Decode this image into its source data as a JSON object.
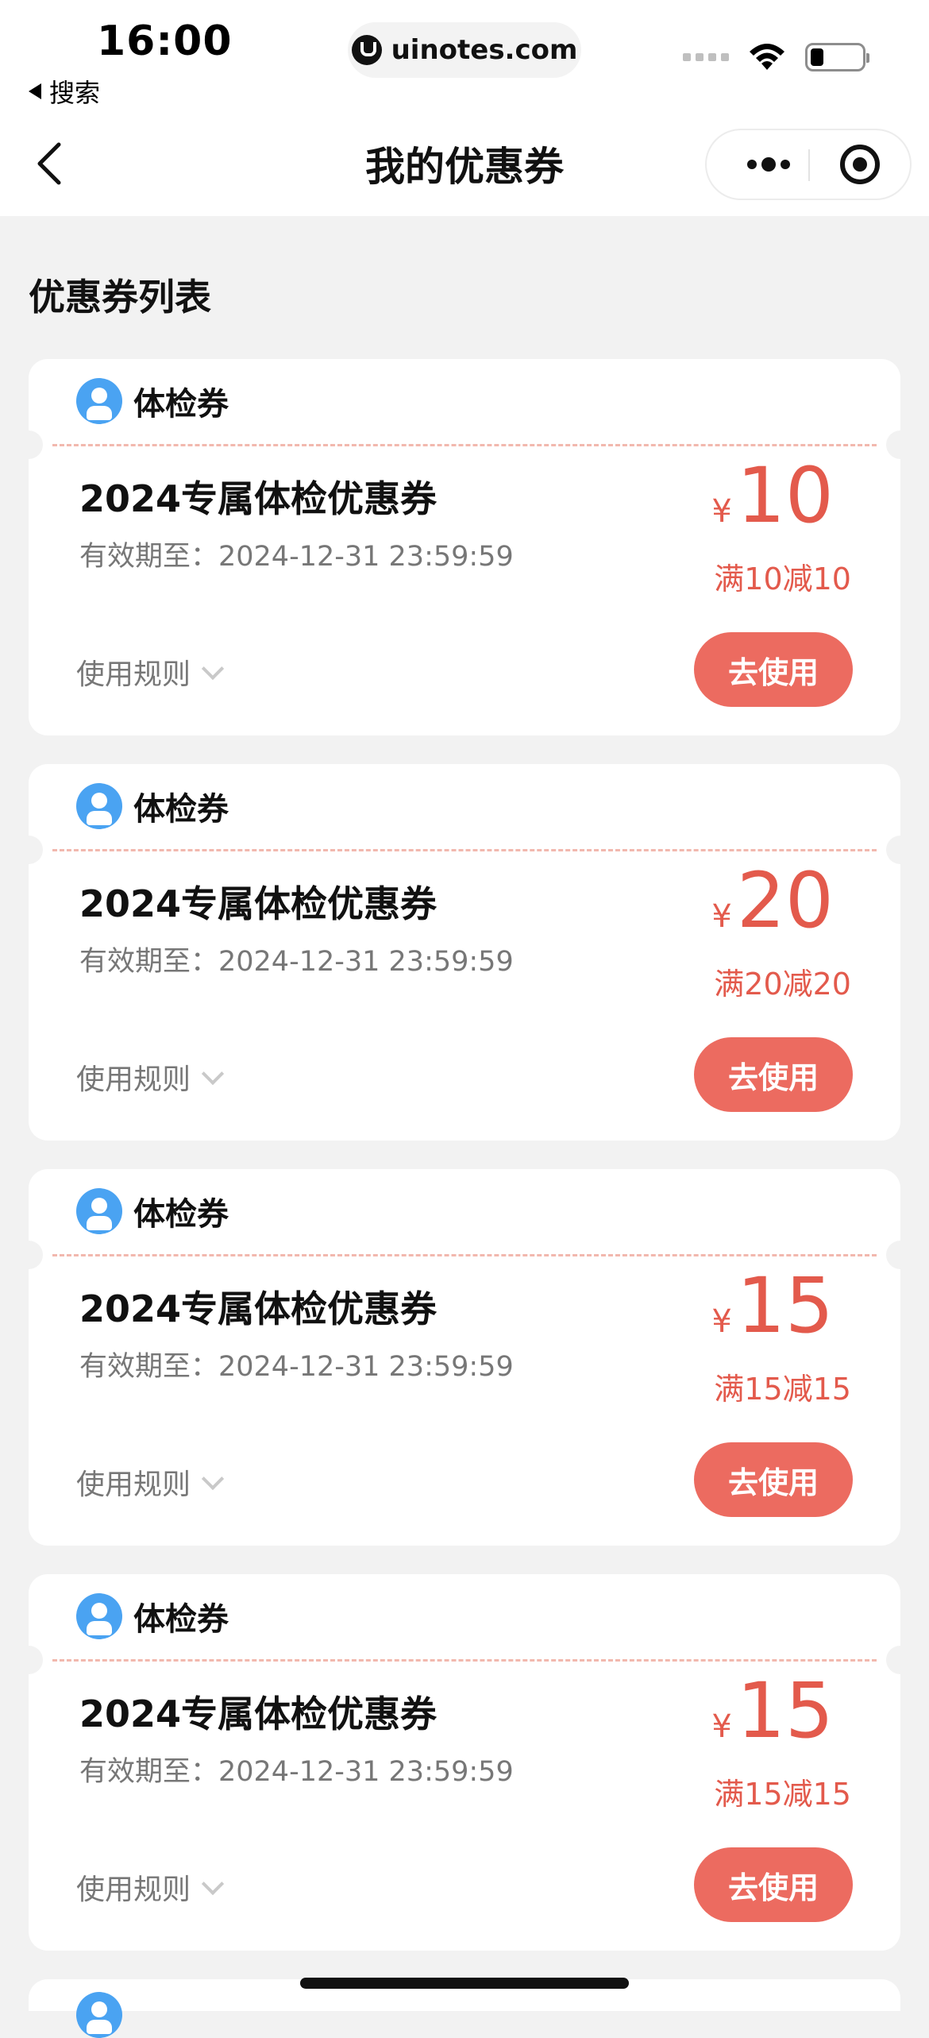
{
  "status_bar": {
    "time": "16:00",
    "back_label": "搜索",
    "url": "uinotes.com"
  },
  "nav": {
    "title": "我的优惠券"
  },
  "section": {
    "title": "优惠券列表"
  },
  "coupons": [
    {
      "tag": "体检券",
      "name": "2024专属体检优惠券",
      "expiry": "有效期至：2024-12-31 23:59:59",
      "currency": "¥",
      "amount": "10",
      "condition": "满10减10",
      "rules_label": "使用规则",
      "button": "去使用"
    },
    {
      "tag": "体检券",
      "name": "2024专属体检优惠券",
      "expiry": "有效期至：2024-12-31 23:59:59",
      "currency": "¥",
      "amount": "20",
      "condition": "满20减20",
      "rules_label": "使用规则",
      "button": "去使用"
    },
    {
      "tag": "体检券",
      "name": "2024专属体检优惠券",
      "expiry": "有效期至：2024-12-31 23:59:59",
      "currency": "¥",
      "amount": "15",
      "condition": "满15减15",
      "rules_label": "使用规则",
      "button": "去使用"
    },
    {
      "tag": "体检券",
      "name": "2024专属体检优惠券",
      "expiry": "有效期至：2024-12-31 23:59:59",
      "currency": "¥",
      "amount": "15",
      "condition": "满15减15",
      "rules_label": "使用规则",
      "button": "去使用"
    }
  ],
  "colors": {
    "accent": "#ec6b60",
    "price": "#e35a4c",
    "tag_icon": "#4aa3f2",
    "background": "#f2f2f2"
  },
  "icons": {
    "tag": "user-badge-icon",
    "rules": "chevron-down-icon",
    "nav_back": "chevron-left-icon",
    "more": "more-dots-icon",
    "close": "target-circle-icon"
  }
}
